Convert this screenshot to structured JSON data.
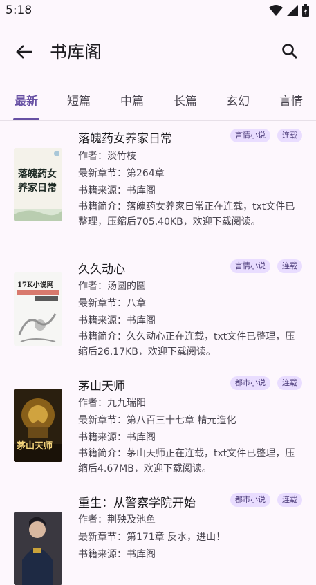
{
  "status": {
    "time": "5:18"
  },
  "appbar": {
    "title": "书库阁"
  },
  "tabs": [
    "最新",
    "短篇",
    "中篇",
    "长篇",
    "玄幻",
    "言情"
  ],
  "labels": {
    "author": "作者：",
    "chapter": "最新章节：",
    "source": "书籍来源：",
    "intro": "书籍简介："
  },
  "books": [
    {
      "title": "落魄药女养家日常",
      "genre": "言情小说",
      "status": "连载",
      "author": "淡竹枝",
      "chapter": "第264章",
      "source": "书库阁",
      "intro": "落魄药女养家日常正在连载，txt文件已整理，压缩后705.40KB，欢迎下载阅读。",
      "cover_text": "落魄药女养家日常"
    },
    {
      "title": "久久动心",
      "genre": "言情小说",
      "status": "连载",
      "author": "汤圆的圆",
      "chapter": "八章",
      "source": "书库阁",
      "intro": "久久动心正在连载，txt文件已整理，压缩后26.17KB，欢迎下载阅读。",
      "cover_text": "17K小说网"
    },
    {
      "title": "茅山天师",
      "genre": "都市小说",
      "status": "连载",
      "author": "九九瑞阳",
      "chapter": "第八百三十七章 精元造化",
      "source": "书库阁",
      "intro": "茅山天师正在连载，txt文件已整理，压缩后4.67MB，欢迎下载阅读。",
      "cover_text": "茅山天师"
    },
    {
      "title": "重生：从警察学院开始",
      "genre": "都市小说",
      "status": "连载",
      "author": "荆殃及池鱼",
      "chapter": "第171章 反水，进山！",
      "source": "书库阁",
      "intro": "",
      "cover_text": ""
    }
  ]
}
